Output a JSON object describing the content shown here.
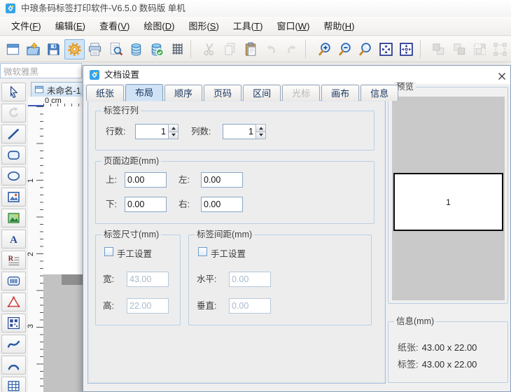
{
  "window": {
    "title": "中琅条码标签打印软件-V6.5.0 数码版 单机"
  },
  "menu": {
    "items": [
      {
        "name": "menu-file",
        "pre": "文件(",
        "key": "F",
        "post": ")"
      },
      {
        "name": "menu-edit",
        "pre": "编辑(",
        "key": "E",
        "post": ")"
      },
      {
        "name": "menu-view",
        "pre": "查看(",
        "key": "V",
        "post": ")"
      },
      {
        "name": "menu-draw",
        "pre": "绘图(",
        "key": "D",
        "post": ")"
      },
      {
        "name": "menu-shape",
        "pre": "图形(",
        "key": "S",
        "post": ")"
      },
      {
        "name": "menu-tools",
        "pre": "工具(",
        "key": "T",
        "post": ")"
      },
      {
        "name": "menu-window",
        "pre": "窗口(",
        "key": "W",
        "post": ")"
      },
      {
        "name": "menu-help",
        "pre": "帮助(",
        "key": "H",
        "post": ")"
      }
    ]
  },
  "toolbar": {
    "buttons": [
      {
        "name": "new-document-button",
        "icon": "i-new"
      },
      {
        "name": "open-file-button",
        "icon": "i-open"
      },
      {
        "name": "save-button",
        "icon": "i-save"
      },
      {
        "name": "document-settings-button",
        "icon": "i-gear",
        "active": true
      },
      {
        "name": "print-button",
        "icon": "i-print"
      },
      {
        "name": "print-preview-button",
        "icon": "i-preview"
      },
      {
        "name": "database-button",
        "icon": "i-db"
      },
      {
        "name": "database-connect-button",
        "icon": "i-dbcheck"
      },
      {
        "name": "grid-settings-button",
        "icon": "i-grid"
      },
      {
        "sep": true
      },
      {
        "name": "cut-button",
        "icon": "i-cut",
        "disabled": true
      },
      {
        "name": "copy-button",
        "icon": "i-copy",
        "disabled": true
      },
      {
        "name": "paste-button",
        "icon": "i-paste"
      },
      {
        "name": "undo-button",
        "icon": "i-undo",
        "disabled": true
      },
      {
        "name": "redo-button",
        "icon": "i-redo",
        "disabled": true
      },
      {
        "sep": true
      },
      {
        "name": "zoom-in-button",
        "icon": "i-zoomin"
      },
      {
        "name": "zoom-out-button",
        "icon": "i-zoomout"
      },
      {
        "name": "zoom-button",
        "icon": "i-zoomreset"
      },
      {
        "name": "fit-page-button",
        "icon": "i-fitin"
      },
      {
        "name": "fit-selection-button",
        "icon": "i-fitout"
      },
      {
        "sep": true
      },
      {
        "name": "bring-front-button",
        "icon": "i-front",
        "disabled": true
      },
      {
        "name": "send-back-button",
        "icon": "i-back",
        "disabled": true
      },
      {
        "name": "group-button",
        "icon": "i-group",
        "disabled": true
      },
      {
        "name": "ungroup-button",
        "icon": "i-ungroup",
        "disabled": true
      }
    ]
  },
  "font_selector": {
    "value": "微软雅黑"
  },
  "document_tab": {
    "label": "未命名-1"
  },
  "ruler": {
    "origin_label": "0 cm",
    "v_marks": [
      "1",
      "2",
      "3"
    ]
  },
  "palette": {
    "tools": [
      {
        "name": "select-tool",
        "icon": "p-select"
      },
      {
        "name": "rotate-tool",
        "icon": "p-rotate",
        "disabled": true
      },
      {
        "name": "line-tool",
        "icon": "p-line"
      },
      {
        "name": "rounded-rect-tool",
        "icon": "p-roundrect"
      },
      {
        "name": "ellipse-tool",
        "icon": "p-ellipse"
      },
      {
        "name": "image-frame-tool",
        "icon": "p-imgframe"
      },
      {
        "name": "picture-tool",
        "icon": "p-picture"
      },
      {
        "name": "text-tool",
        "icon": "p-text"
      },
      {
        "name": "rich-text-tool",
        "icon": "p-richtext"
      },
      {
        "name": "barcode-tool",
        "icon": "p-barcode"
      },
      {
        "name": "shape-tool",
        "icon": "p-shape"
      },
      {
        "name": "qrcode-tool",
        "icon": "p-qrcode"
      },
      {
        "name": "curve-tool",
        "icon": "p-curve"
      },
      {
        "name": "arc-tool",
        "icon": "p-arc"
      },
      {
        "name": "table-tool",
        "icon": "p-table"
      }
    ]
  },
  "dialog": {
    "title": "文档设置",
    "tabs": [
      {
        "name": "tab-paper",
        "label": "纸张"
      },
      {
        "name": "tab-layout",
        "label": "布局",
        "active": true
      },
      {
        "name": "tab-order",
        "label": "顺序"
      },
      {
        "name": "tab-page-number",
        "label": "页码"
      },
      {
        "name": "tab-range",
        "label": "区间"
      },
      {
        "name": "tab-cursor",
        "label": "光标",
        "disabled": true
      },
      {
        "name": "tab-canvas",
        "label": "画布"
      },
      {
        "name": "tab-info",
        "label": "信息"
      }
    ],
    "rows_cols_group": {
      "title": "标签行列",
      "rows_label": "行数:",
      "rows_value": "1",
      "cols_label": "列数:",
      "cols_value": "1"
    },
    "margins_group": {
      "title": "页面边距(mm)",
      "top_label": "上:",
      "top_value": "0.00",
      "left_label": "左:",
      "left_value": "0.00",
      "bottom_label": "下:",
      "bottom_value": "0.00",
      "right_label": "右:",
      "right_value": "0.00"
    },
    "size_group": {
      "title": "标签尺寸(mm)",
      "manual_label": "手工设置",
      "width_label": "宽:",
      "width_value": "43.00",
      "height_label": "高:",
      "height_value": "22.00"
    },
    "gap_group": {
      "title": "标签间距(mm)",
      "manual_label": "手工设置",
      "h_label": "水平:",
      "h_value": "0.00",
      "v_label": "垂直:",
      "v_value": "0.00"
    },
    "preview_group": {
      "title": "预览",
      "cell_label": "1"
    },
    "info_group": {
      "title": "信息(mm)",
      "paper_label": "纸张:",
      "paper_value": "43.00 x 22.00",
      "label_label": "标签:",
      "label_value": "43.00 x 22.00"
    }
  },
  "colors": {
    "tab_active_bg": "#cfe2f6",
    "dialog_bg": "#f0f0f0",
    "panel_bg": "#ededee",
    "preview_bg": "#c9c9c9",
    "disabled_text": "#a9bacd",
    "gear_orange": "#f0a330",
    "accent_blue": "#2a5aa5",
    "workspace_gray": "#c2c2c2"
  }
}
